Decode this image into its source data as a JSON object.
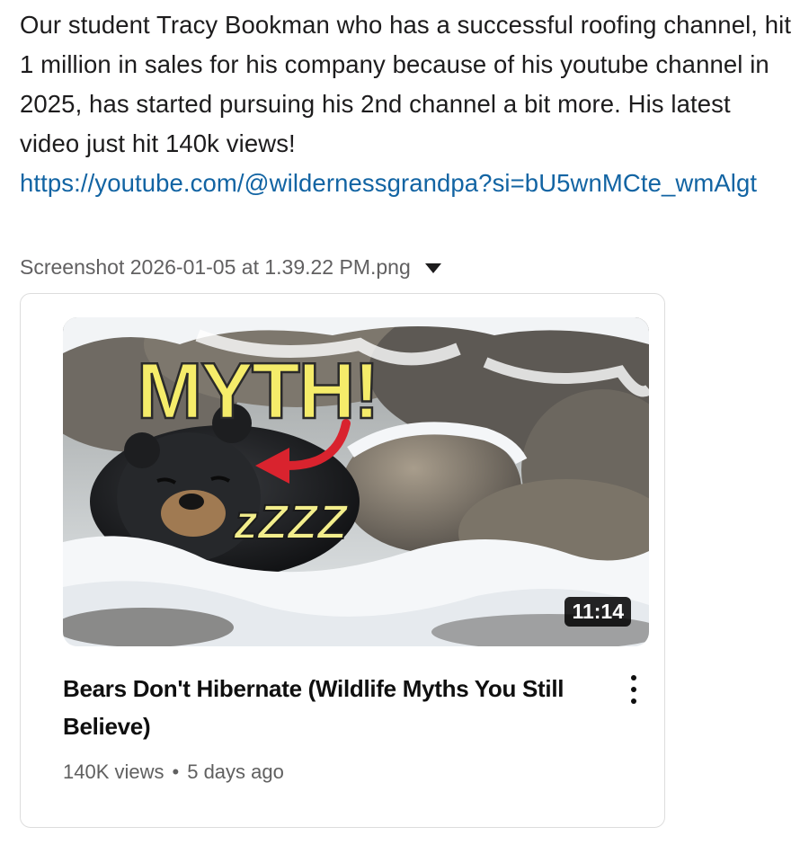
{
  "message": {
    "text": "Our student Tracy Bookman who has a successful roofing channel, hit 1 million in sales for his company because of his youtube channel in 2025, has started pursuing his 2nd channel a bit more. His latest video just hit 140k views!",
    "link": "https://youtube.com/@wildernessgrandpa?si=bU5wnMCte_wmAlgt"
  },
  "attachment": {
    "filename": "Screenshot 2026-01-05 at 1.39.22 PM.png",
    "icon": "caret-down-icon"
  },
  "video": {
    "thumbnail_text": "MYTH!",
    "thumbnail_zzz": "zZZZ",
    "duration": "11:14",
    "title": "Bears Don't Hibernate (Wildlife Myths You Still Believe)",
    "views": "140K views",
    "separator": "•",
    "age": "5 days ago",
    "menu_icon": "more-vertical-icon"
  },
  "colors": {
    "link": "#1264a3",
    "myth_yellow": "#f5ec6a",
    "arrow_red": "#d9232e"
  }
}
